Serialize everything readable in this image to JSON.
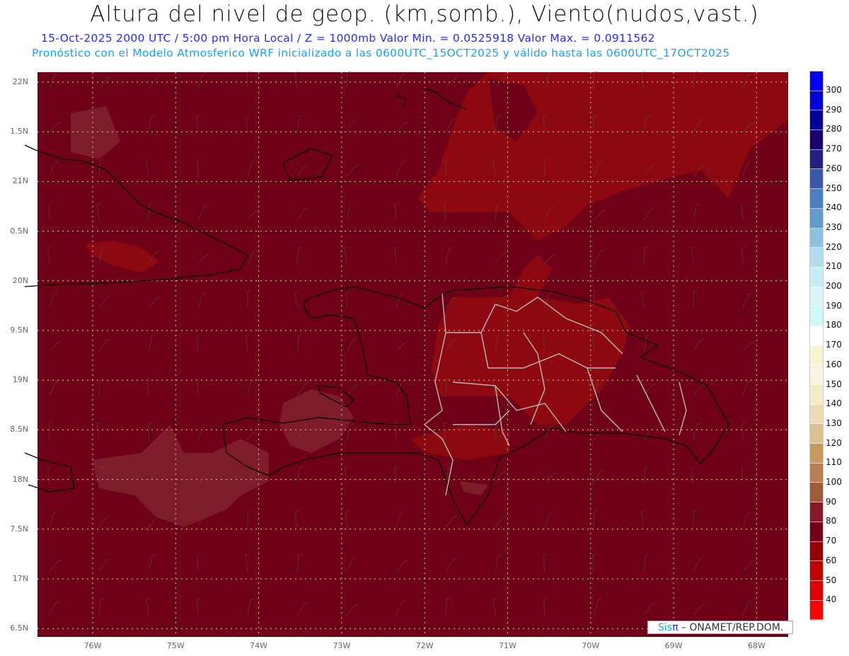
{
  "header": {
    "title": "Altura del nivel de geop. (km,somb.), Viento(nudos,vast.)",
    "subtitle1": "15-Oct-2025  2000 UTC / 5:00 pm Hora Local / Z = 1000mb Valor Min. = 0.0525918  Valor Max. = 0.0911562",
    "subtitle2": "Pronóstico con el Modelo Atmosferico WRF inicializado a las 0600UTC_15OCT2025 y válido hasta las  0600UTC_17OCT2025"
  },
  "map": {
    "lat_labels": [
      "22N",
      "1.5N",
      "21N",
      "0.5N",
      "20N",
      "9.5N",
      "19N",
      "8.5N",
      "18N",
      "7.5N",
      "17N",
      "6.5N"
    ],
    "lon_labels": [
      "76W",
      "75W",
      "74W",
      "73W",
      "72W",
      "71W",
      "70W",
      "69W",
      "68W"
    ],
    "colors": {
      "background": "#6e0018",
      "higher": "#8e0810",
      "lower": "#7e1c2a",
      "coast": "#000000",
      "borders": "#b8b8b8"
    }
  },
  "colorbar": {
    "labels": [
      "300",
      "290",
      "280",
      "270",
      "260",
      "250",
      "240",
      "230",
      "220",
      "210",
      "200",
      "190",
      "180",
      "170",
      "160",
      "150",
      "140",
      "130",
      "120",
      "110",
      "100",
      "90",
      "80",
      "70",
      "60",
      "50",
      "40"
    ],
    "colors": [
      "#0000ff",
      "#0000d8",
      "#000099",
      "#1a006e",
      "#24207f",
      "#3a56a8",
      "#4a80c0",
      "#609ccc",
      "#8cc2e0",
      "#b0dcec",
      "#c6ecf4",
      "#dcf4f8",
      "#ccfafa",
      "#ffffff",
      "#f8f4d0",
      "#f8f4e4",
      "#f4ecc8",
      "#ecdcb0",
      "#dcc090",
      "#c89860",
      "#b88050",
      "#a05a3c",
      "#861a28",
      "#6e0018",
      "#960000",
      "#c00000",
      "#dc0000",
      "#ff0000"
    ]
  },
  "credit": {
    "sis": "Sis",
    "pi": "π",
    "text": " –  ONAMET/REP.DOM."
  }
}
